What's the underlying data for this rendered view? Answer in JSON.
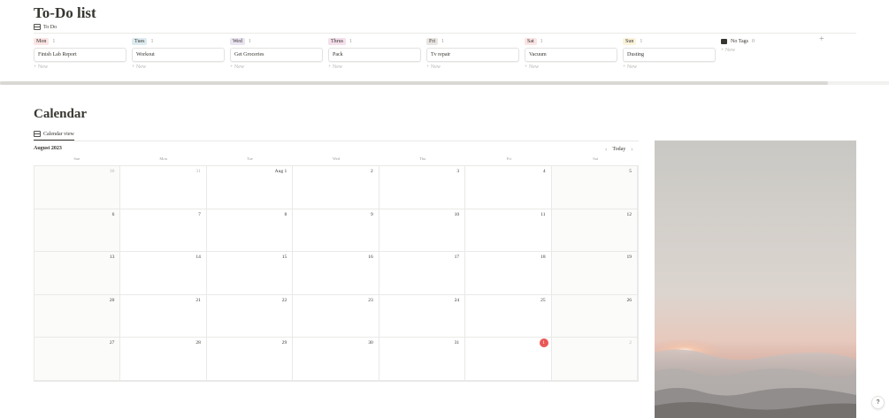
{
  "todo": {
    "title": "To-Do list",
    "view_tab": "To Do",
    "columns": [
      {
        "tag": "Mon",
        "count": "1",
        "color": "#fbe4e4",
        "card": "Finish Lab Report",
        "new": "+ New"
      },
      {
        "tag": "Tues",
        "count": "1",
        "color": "#ddebf1",
        "card": "Workout",
        "new": "+ New"
      },
      {
        "tag": "Wed",
        "count": "1",
        "color": "#eae4f2",
        "card": "Get Groceries",
        "new": "+ New"
      },
      {
        "tag": "Thrus",
        "count": "1",
        "color": "#f4dfeb",
        "card": "Pack",
        "new": "+ New"
      },
      {
        "tag": "Fri",
        "count": "1",
        "color": "#e9e5e3",
        "card": "Tv repair",
        "new": "+ New"
      },
      {
        "tag": "Sat",
        "count": "1",
        "color": "#fbe4e4",
        "card": "Vacuum",
        "new": "+ New"
      },
      {
        "tag": "Sun",
        "count": "1",
        "color": "#fbf3db",
        "card": "Dusting",
        "new": "+ New"
      }
    ],
    "no_tags": {
      "label": "No Tags",
      "count": "0",
      "new": "+ New"
    },
    "add_column": "+"
  },
  "calendar": {
    "title": "Calendar",
    "view_tab": "Calendar view",
    "month": "August 2023",
    "today_label": "Today",
    "prev": "‹",
    "next": "›",
    "weekdays": [
      "Sun",
      "Mon",
      "Tue",
      "Wed",
      "Thu",
      "Fri",
      "Sat"
    ],
    "today_color": "#eb5757",
    "weeks": [
      [
        "30",
        "31",
        "Aug 1",
        "2",
        "3",
        "4",
        "5"
      ],
      [
        "6",
        "7",
        "8",
        "9",
        "10",
        "11",
        "12"
      ],
      [
        "13",
        "14",
        "15",
        "16",
        "17",
        "18",
        "19"
      ],
      [
        "20",
        "21",
        "22",
        "23",
        "24",
        "25",
        "26"
      ],
      [
        "27",
        "28",
        "29",
        "30",
        "31",
        "1",
        "2"
      ]
    ]
  },
  "help": "?"
}
